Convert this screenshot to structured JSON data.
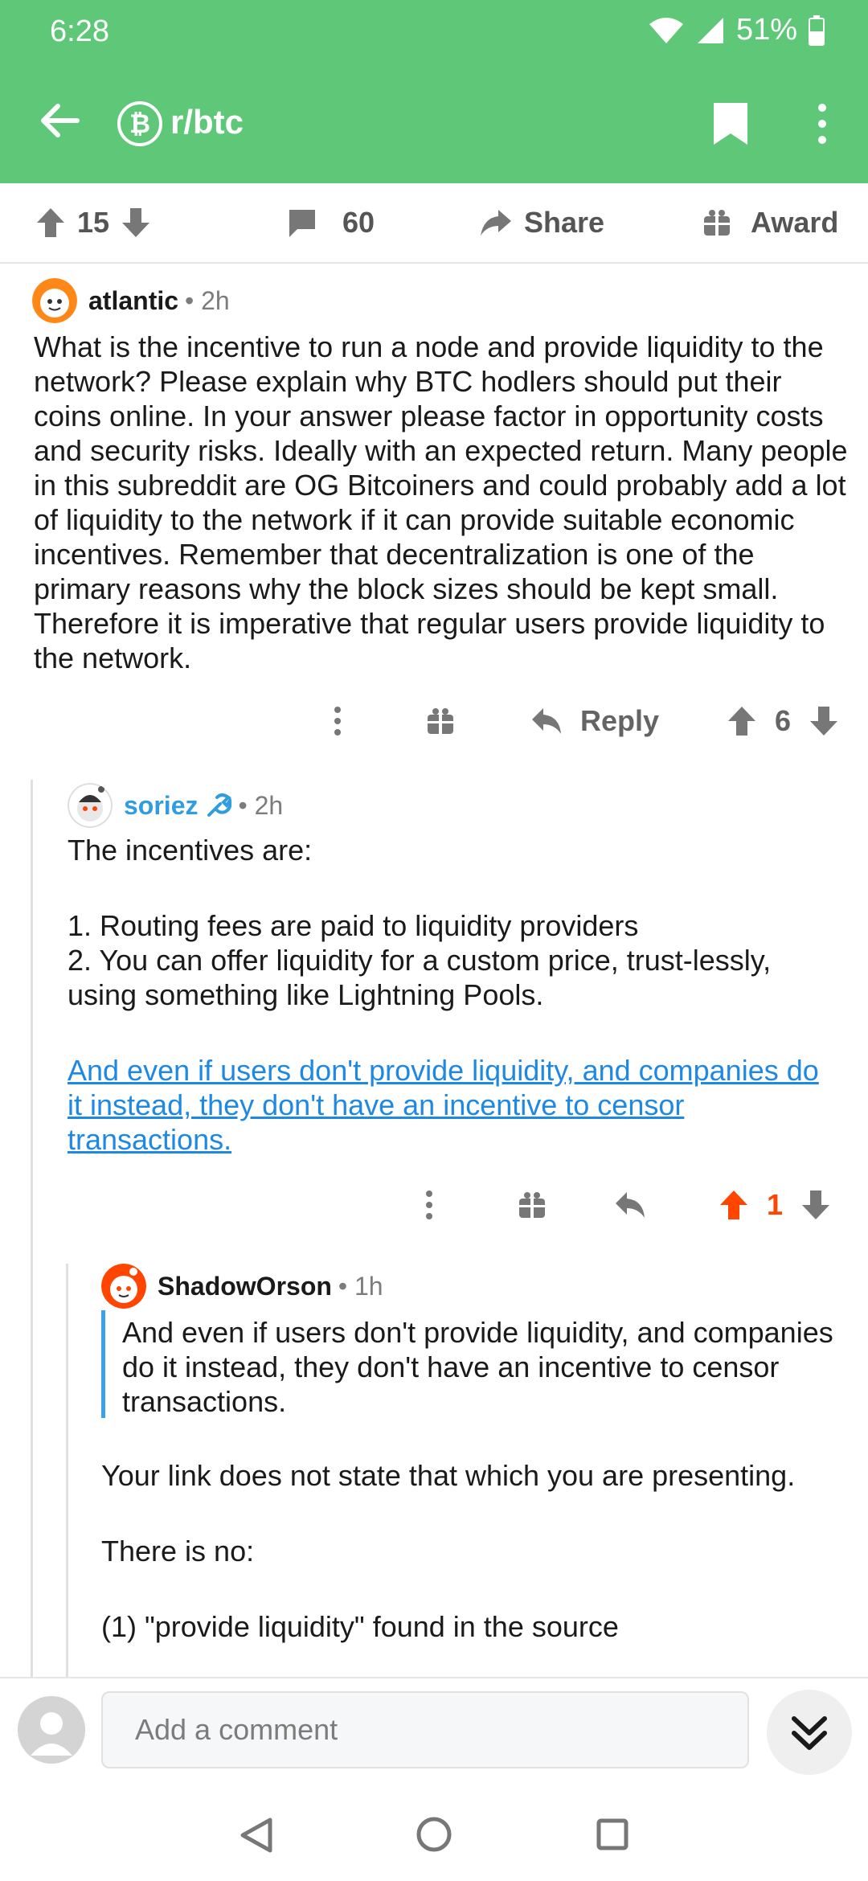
{
  "status": {
    "time": "6:28",
    "battery": "51%"
  },
  "appbar": {
    "subreddit": "r/btc",
    "sub_icon_glyph": "₿"
  },
  "post_bar": {
    "score": "15",
    "comments": "60",
    "share": "Share",
    "award": "Award"
  },
  "comments": [
    {
      "author": "atlantic",
      "meta": "• 2h",
      "body": "What is the incentive to run a node and provide liquidity to the network? Please explain why BTC hodlers should put their coins online. In your answer please factor in opportunity costs and security risks. Ideally with an expected return. Many people in this subreddit are OG Bitcoiners and could probably add a lot of liquidity to the network if it can provide suitable economic incentives. Remember that decentralization is one of the primary reasons why the block sizes should be kept small. Therefore it is imperative that regular users provide liquidity to the network.",
      "reply_label": "Reply",
      "score": "6"
    },
    {
      "author": "soriez",
      "meta": "• 2h",
      "intro": "The incentives are:",
      "list": [
        "1. Routing fees are paid to liquidity providers",
        "2. You can offer liquidity for a custom price, trust-lessly, using something like Lightning Pools."
      ],
      "link": "And even if users don't provide liquidity, and companies do it instead, they don't have an incentive to censor transactions. ",
      "score": "1"
    },
    {
      "author": "ShadowOrson",
      "meta": "• 1h",
      "quote": "And even if users don't provide liquidity, and companies do it instead, they don't have an incentive to censor transactions.",
      "para1": "Your link does not state that which you are presenting.",
      "para2": "There is no:",
      "para3": "(1) \"provide liquidity\" found in the source"
    }
  ],
  "bottom": {
    "placeholder": "Add a comment"
  },
  "colors": {
    "header": "#5ec878",
    "upvoted": "#ff4500",
    "link": "#1e88e5",
    "username_op": "#2f9de0"
  }
}
